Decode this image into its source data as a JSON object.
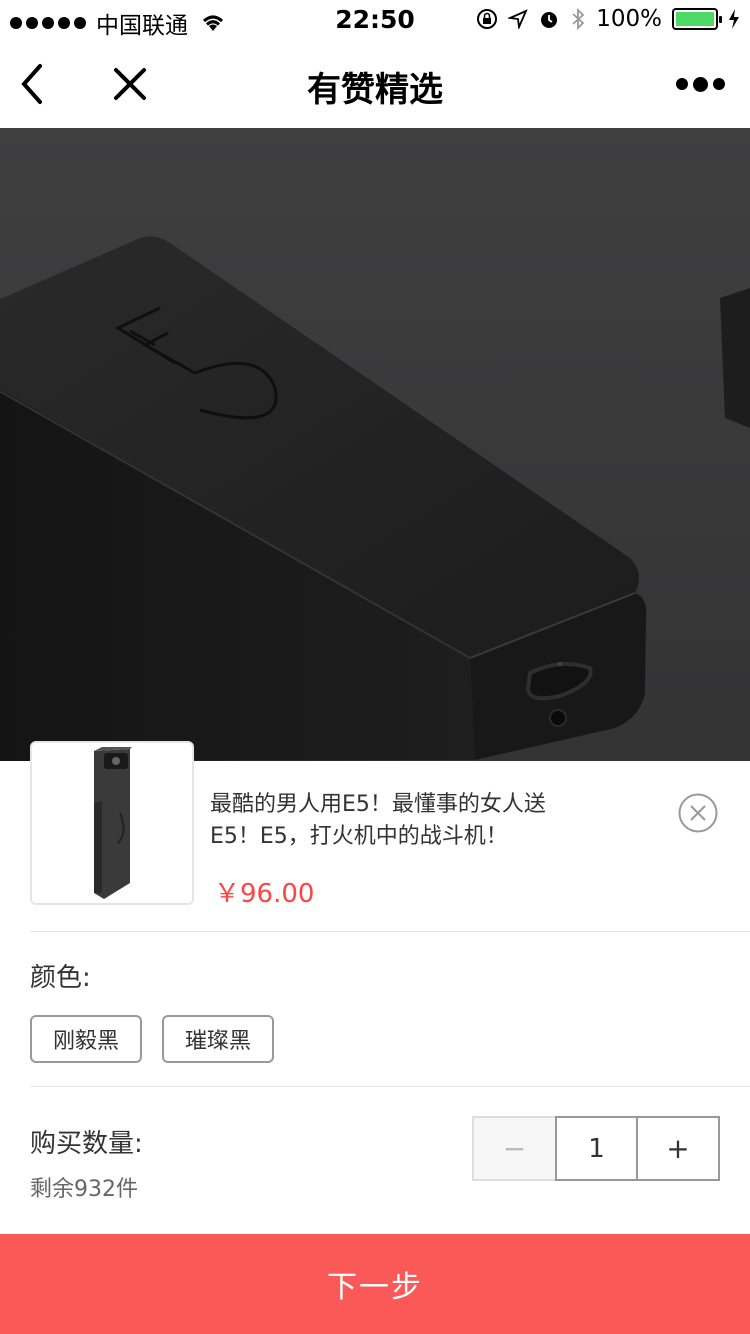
{
  "status_bar": {
    "carrier": "中国联通",
    "time": "22:50",
    "battery": "100%"
  },
  "nav": {
    "title": "有赞精选",
    "icons": [
      "back-arrow-icon",
      "close-icon",
      "more-icon"
    ]
  },
  "product": {
    "title": "最酷的男人用E5！最懂事的女人送E5！E5，打火机中的战斗机！",
    "price": "￥96.00",
    "hero_logo": "E5"
  },
  "color_section": {
    "label": "颜色:",
    "options": [
      "刚毅黑",
      "璀璨黑"
    ]
  },
  "quantity_section": {
    "label": "购买数量:",
    "remaining": "剩余932件",
    "minus": "−",
    "value": "1",
    "plus": "+"
  },
  "actions": {
    "next_label": "下一步"
  },
  "colors": {
    "accent": "#fb5858",
    "price": "#ff4444",
    "battery": "#4cd964"
  }
}
